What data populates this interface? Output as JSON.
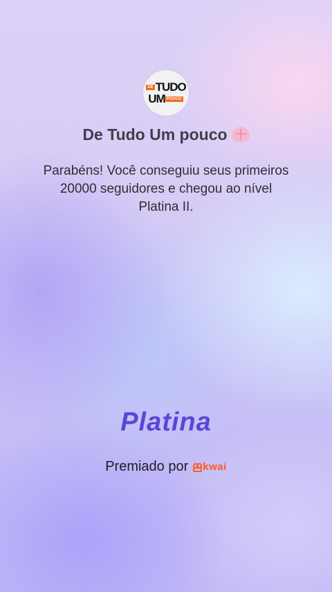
{
  "channel": {
    "logo": {
      "small_text": "DE",
      "line1": "TUDO",
      "line2_big": "UM",
      "line2_small": "POUCO"
    },
    "name": "De Tudo Um pouco",
    "emoji_icon": "brain-icon"
  },
  "message": "Parabéns! Você conseguiu seus primeiros 20000 seguidores e chegou ao nível Platina II.",
  "level": "Platina",
  "award": {
    "label": "Premiado por",
    "brand": "kwai",
    "brand_icon": "kwai-logo-icon",
    "brand_color": "#ff5a1f"
  },
  "colors": {
    "accent": "#5a46d6"
  }
}
